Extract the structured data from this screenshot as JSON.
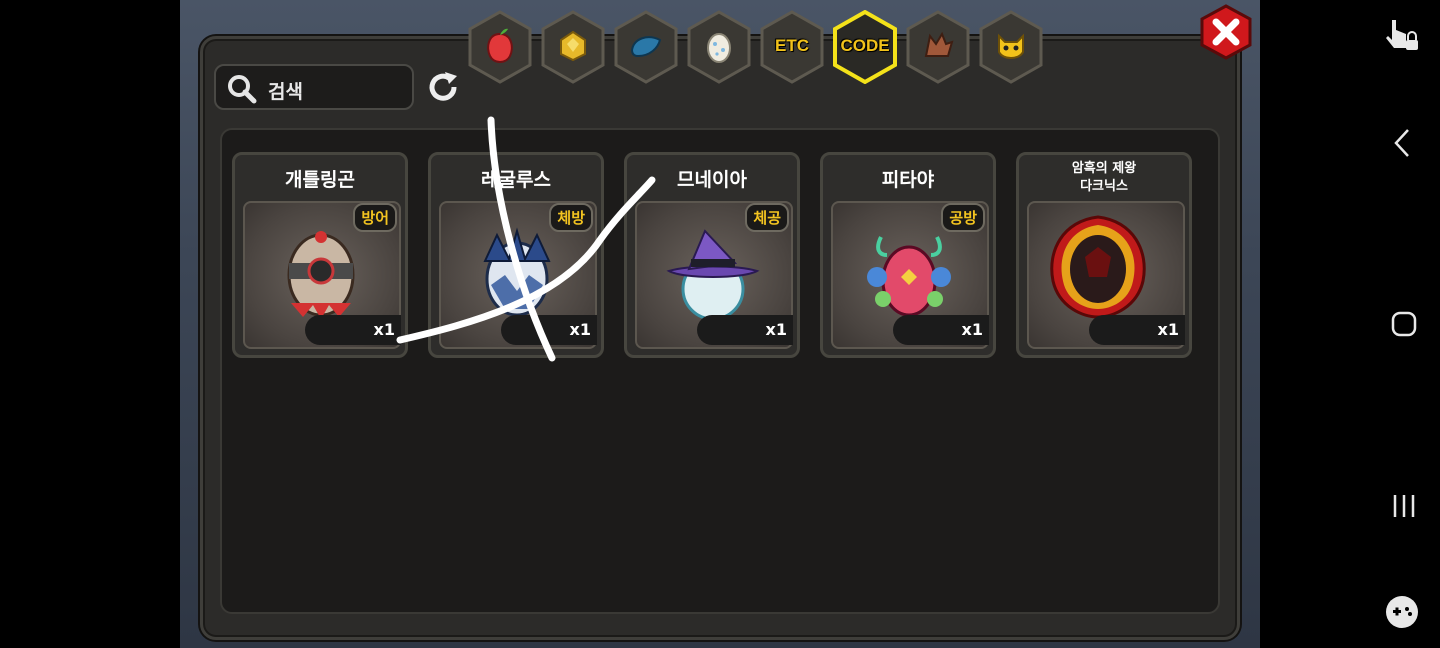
{
  "search": {
    "placeholder": "검색"
  },
  "tabs": [
    {
      "id": "fruit",
      "icon": "fruit-icon",
      "label": ""
    },
    {
      "id": "gold",
      "icon": "gold-ore-icon",
      "label": ""
    },
    {
      "id": "meat",
      "icon": "blue-material-icon",
      "label": ""
    },
    {
      "id": "egg",
      "icon": "egg-icon",
      "label": ""
    },
    {
      "id": "etc",
      "icon": "",
      "label": "ETC"
    },
    {
      "id": "code",
      "icon": "",
      "label": "CODE",
      "selected": true
    },
    {
      "id": "dragon",
      "icon": "dragon-head-icon",
      "label": ""
    },
    {
      "id": "monster",
      "icon": "monster-face-icon",
      "label": ""
    }
  ],
  "items": [
    {
      "name": "개틀링곤",
      "badge": "방어",
      "qty": "x1",
      "icon": "gatlingon-egg-icon"
    },
    {
      "name": "레굴루스",
      "badge": "체방",
      "qty": "x1",
      "icon": "regulus-egg-icon"
    },
    {
      "name": "므네이아",
      "badge": "체공",
      "qty": "x1",
      "icon": "mneia-egg-icon"
    },
    {
      "name": "피타야",
      "badge": "공방",
      "qty": "x1",
      "icon": "pitaya-egg-icon"
    },
    {
      "name": "암흑의 제왕\n다크닉스",
      "badge": "",
      "qty": "x1",
      "icon": "darknix-egg-icon"
    }
  ],
  "colors": {
    "accent": "#f3c420",
    "panel": "#2c2b29",
    "close": "#d0181c",
    "selected_tab": "#f4e21a"
  }
}
